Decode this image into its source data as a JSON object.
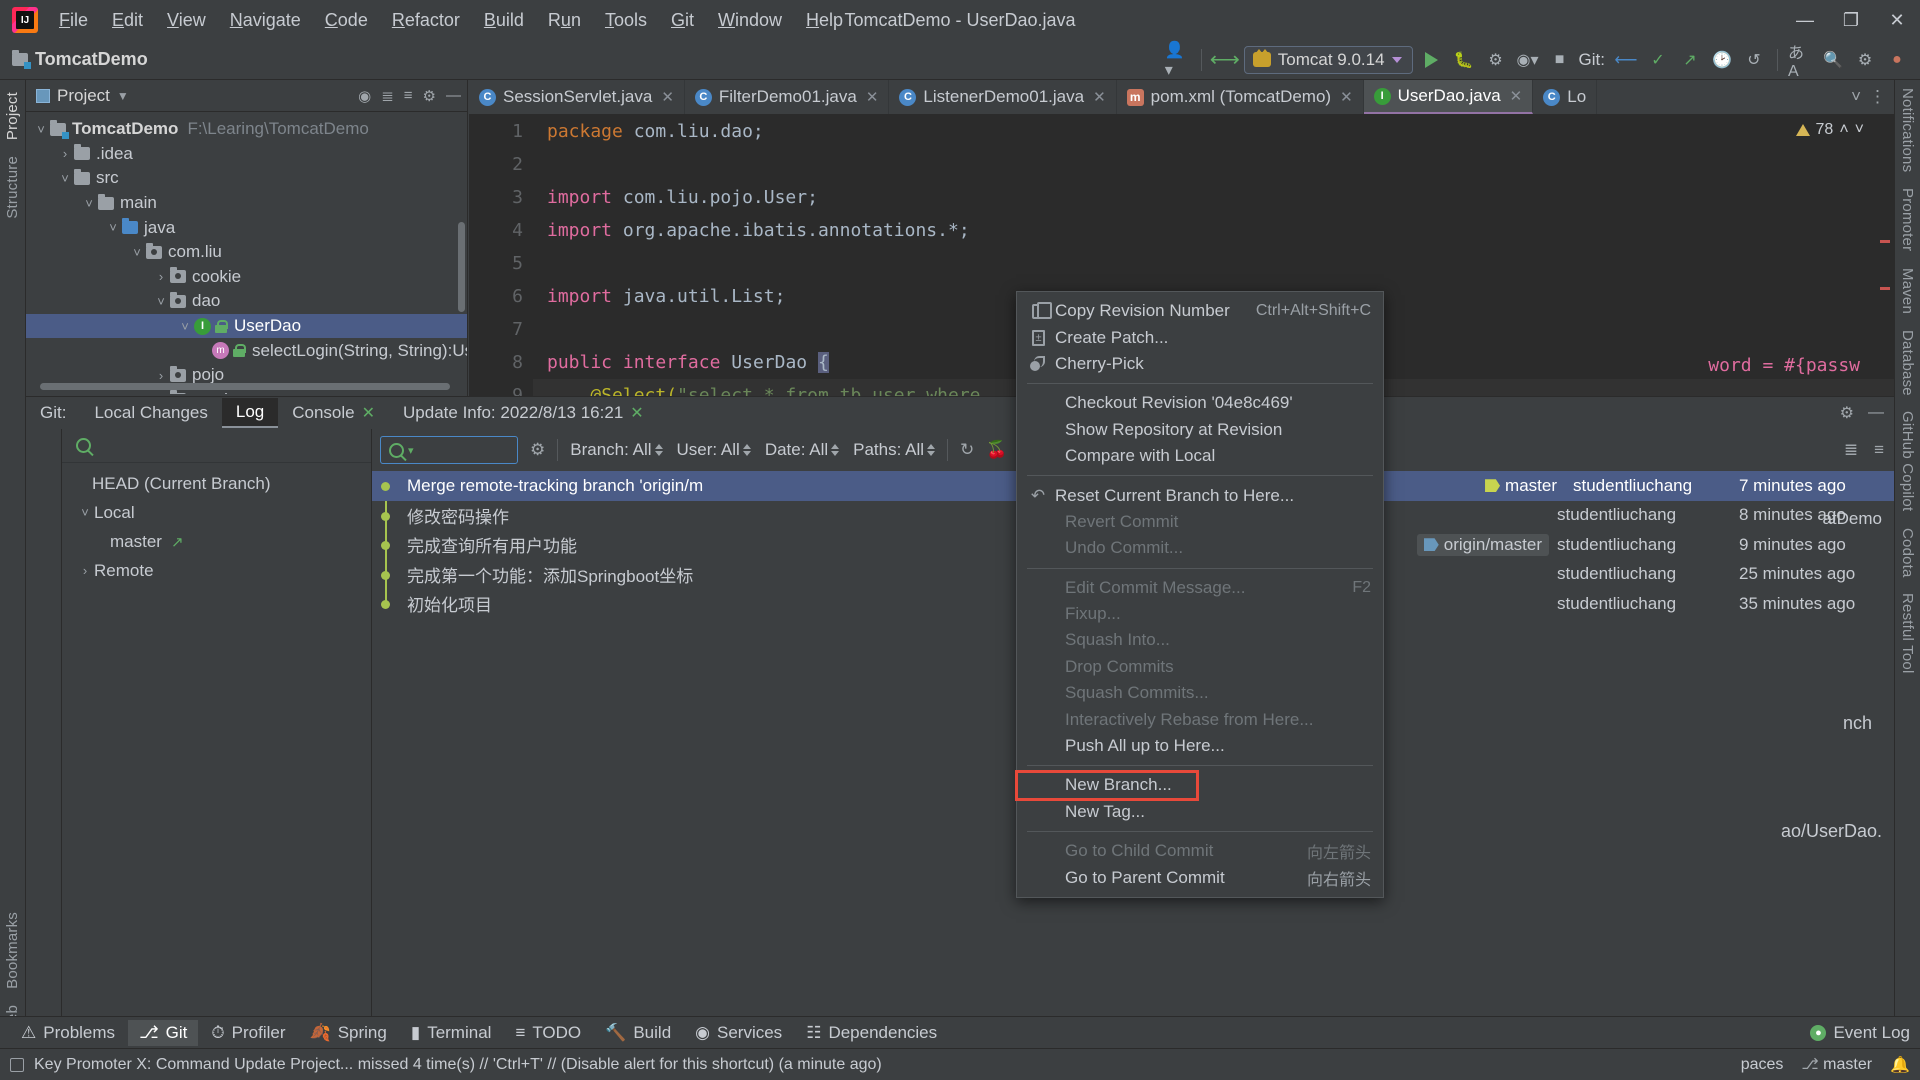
{
  "window": {
    "title": "TomcatDemo - UserDao.java",
    "controls": {
      "minimize": "—",
      "maximize": "❐",
      "close": "✕"
    }
  },
  "menubar": [
    {
      "label": "File",
      "mnemonic": "F"
    },
    {
      "label": "Edit",
      "mnemonic": "E"
    },
    {
      "label": "View",
      "mnemonic": "V"
    },
    {
      "label": "Navigate",
      "mnemonic": "N"
    },
    {
      "label": "Code",
      "mnemonic": "C"
    },
    {
      "label": "Refactor",
      "mnemonic": "R"
    },
    {
      "label": "Build",
      "mnemonic": "B"
    },
    {
      "label": "Run",
      "mnemonic": "u"
    },
    {
      "label": "Tools",
      "mnemonic": "T"
    },
    {
      "label": "Git",
      "mnemonic": "G"
    },
    {
      "label": "Window",
      "mnemonic": "W"
    },
    {
      "label": "Help",
      "mnemonic": "H"
    }
  ],
  "toolbar": {
    "project_name": "TomcatDemo",
    "run_config": "Tomcat 9.0.14",
    "git_label": "Git:"
  },
  "left_strip": {
    "top": [
      "Project",
      "Structure"
    ],
    "bottom": [
      "Bookmarks",
      "Web"
    ]
  },
  "right_strip": {
    "top": [
      "Notifications",
      "Promoter",
      "Maven",
      "Database"
    ],
    "bottom": [
      "Codota",
      "Restful Tool",
      "GitHub Copilot"
    ]
  },
  "project_tool_window": {
    "title": "Project",
    "tree": [
      {
        "label": "TomcatDemo",
        "path": "F:\\Learing\\TomcatDemo",
        "indent": 0,
        "chev": "v",
        "icon": "module-folder",
        "bold": true
      },
      {
        "label": ".idea",
        "indent": 1,
        "chev": ">",
        "icon": "folder"
      },
      {
        "label": "src",
        "indent": 1,
        "chev": "v",
        "icon": "folder"
      },
      {
        "label": "main",
        "indent": 2,
        "chev": "v",
        "icon": "folder"
      },
      {
        "label": "java",
        "indent": 3,
        "chev": "v",
        "icon": "source-folder"
      },
      {
        "label": "com.liu",
        "indent": 4,
        "chev": "v",
        "icon": "package"
      },
      {
        "label": "cookie",
        "indent": 5,
        "chev": ">",
        "icon": "package"
      },
      {
        "label": "dao",
        "indent": 5,
        "chev": "v",
        "icon": "package"
      },
      {
        "label": "UserDao",
        "indent": 6,
        "chev": "v",
        "icon": "interface",
        "selected": true,
        "lock": true
      },
      {
        "label": "selectLogin(String, String):User",
        "indent": 7,
        "chev": "",
        "icon": "method",
        "lock": true
      },
      {
        "label": "pojo",
        "indent": 5,
        "chev": ">",
        "icon": "package"
      },
      {
        "label": "service",
        "indent": 5,
        "chev": ">",
        "icon": "package"
      }
    ]
  },
  "editor": {
    "tabs": [
      {
        "label": "SessionServlet.java",
        "icon": "class-blue",
        "closable": true
      },
      {
        "label": "FilterDemo01.java",
        "icon": "class-c",
        "closable": true
      },
      {
        "label": "ListenerDemo01.java",
        "icon": "class-c",
        "closable": true
      },
      {
        "label": "pom.xml (TomcatDemo)",
        "icon": "maven",
        "closable": true
      },
      {
        "label": "UserDao.java",
        "icon": "interface",
        "closable": true,
        "active": true
      },
      {
        "label": "Lo",
        "icon": "class-c",
        "closable": false
      }
    ],
    "warning_count": "78",
    "lines": [
      {
        "n": "1",
        "html": "<span class=\"kw\">package</span> <span class=\"pkgc\">com.liu.dao;</span>"
      },
      {
        "n": "2",
        "html": ""
      },
      {
        "n": "3",
        "html": "<span class=\"kwp\">import</span> <span class=\"pkgc\">com.liu.pojo.User;</span>",
        "fold": "−"
      },
      {
        "n": "4",
        "html": "<span class=\"kwp\">import</span> <span class=\"pkgc\">org.apache.ibatis.annotations.*;</span>"
      },
      {
        "n": "5",
        "html": ""
      },
      {
        "n": "6",
        "html": "<span class=\"kwp\">import</span> <span class=\"pkgc\">java.util.List;</span>",
        "fold": "⌐"
      },
      {
        "n": "7",
        "html": ""
      },
      {
        "n": "8",
        "html": "<span class=\"kwp\">public</span> <span class=\"kwp\">interface</span> <span class=\"cls\">UserDao</span> <span class=\"sel-br\">{</span>"
      },
      {
        "n": "9",
        "html": "    <span class=\"anno\">@Select(</span><span class=\"str\">\"select * from tb_user where</span>"
      }
    ],
    "code_tail": "word = #{passw"
  },
  "git_tool_window": {
    "label": "Git:",
    "tabs": [
      {
        "label": "Local Changes",
        "active": false,
        "closable": false
      },
      {
        "label": "Log",
        "active": true,
        "closable": false
      },
      {
        "label": "Console",
        "active": false,
        "closable": true
      },
      {
        "label": "Update Info: 2022/8/13 16:21",
        "active": false,
        "closable": true
      }
    ],
    "branch_panel": [
      {
        "label": "HEAD (Current Branch)",
        "indent": 1,
        "chev": ""
      },
      {
        "label": "Local",
        "indent": 0,
        "chev": "v"
      },
      {
        "label": "master",
        "indent": 1,
        "chev": "",
        "arrow": "↗"
      },
      {
        "label": "Remote",
        "indent": 0,
        "chev": ">"
      }
    ],
    "log_filters": {
      "search_placeholder": "",
      "branch": "Branch: All",
      "user": "User: All",
      "date": "Date: All",
      "paths": "Paths: All"
    },
    "commits": [
      {
        "message": "Merge remote-tracking branch 'origin/m",
        "tag": "master",
        "author": "studentliuchang",
        "date": "7 minutes ago",
        "selected": true
      },
      {
        "message": "修改密码操作",
        "author": "studentliuchang",
        "date": "8 minutes ago"
      },
      {
        "message": "完成查询所有用户功能",
        "origin_tag": "origin/master",
        "author": "studentliuchang",
        "date": "9 minutes ago"
      },
      {
        "message": "完成第一个功能：添加Springboot坐标",
        "author": "studentliuchang",
        "date": "25 minutes ago"
      },
      {
        "message": "初始化项目",
        "author": "studentliuchang",
        "date": "35 minutes ago"
      }
    ],
    "detail_panel": [
      "atDemo",
      "nch",
      "ao/UserDao."
    ]
  },
  "context_menu": {
    "items": [
      {
        "label": "Copy Revision Number",
        "shortcut": "Ctrl+Alt+Shift+C",
        "icon": "copy-icon",
        "disabled": false
      },
      {
        "label": "Create Patch...",
        "shortcut": "",
        "icon": "patch-icon",
        "disabled": false
      },
      {
        "label": "Cherry-Pick",
        "shortcut": "",
        "icon": "cherry-icon",
        "disabled": false
      },
      {
        "separator": true
      },
      {
        "label": "Checkout Revision '04e8c469'",
        "shortcut": "",
        "icon": "",
        "disabled": false
      },
      {
        "label": "Show Repository at Revision",
        "shortcut": "",
        "icon": "",
        "disabled": false
      },
      {
        "label": "Compare with Local",
        "shortcut": "",
        "icon": "",
        "disabled": false
      },
      {
        "separator": true
      },
      {
        "label": "Reset Current Branch to Here...",
        "shortcut": "",
        "icon": "reset-icon",
        "disabled": false
      },
      {
        "label": "Revert Commit",
        "shortcut": "",
        "icon": "",
        "disabled": true
      },
      {
        "label": "Undo Commit...",
        "shortcut": "",
        "icon": "",
        "disabled": true
      },
      {
        "separator": true
      },
      {
        "label": "Edit Commit Message...",
        "shortcut": "F2",
        "icon": "",
        "disabled": true
      },
      {
        "label": "Fixup...",
        "shortcut": "",
        "icon": "",
        "disabled": true
      },
      {
        "label": "Squash Into...",
        "shortcut": "",
        "icon": "",
        "disabled": true
      },
      {
        "label": "Drop Commits",
        "shortcut": "",
        "icon": "",
        "disabled": true
      },
      {
        "label": "Squash Commits...",
        "shortcut": "",
        "icon": "",
        "disabled": true
      },
      {
        "label": "Interactively Rebase from Here...",
        "shortcut": "",
        "icon": "",
        "disabled": true
      },
      {
        "label": "Push All up to Here...",
        "shortcut": "",
        "icon": "",
        "disabled": false
      },
      {
        "separator": true
      },
      {
        "label": "New Branch...",
        "shortcut": "",
        "icon": "",
        "disabled": false,
        "highlighted": true
      },
      {
        "label": "New Tag...",
        "shortcut": "",
        "icon": "",
        "disabled": false
      },
      {
        "separator": true
      },
      {
        "label": "Go to Child Commit",
        "shortcut": "向左箭头",
        "icon": "",
        "disabled": true
      },
      {
        "label": "Go to Parent Commit",
        "shortcut": "向右箭头",
        "icon": "",
        "disabled": false
      }
    ]
  },
  "bottom_tabs": [
    {
      "label": "Problems",
      "icon": "problems-icon",
      "active": false
    },
    {
      "label": "Git",
      "icon": "git-icon",
      "active": true
    },
    {
      "label": "Profiler",
      "icon": "profiler-icon",
      "active": false
    },
    {
      "label": "Spring",
      "icon": "spring-icon",
      "active": false
    },
    {
      "label": "Terminal",
      "icon": "terminal-icon",
      "active": false
    },
    {
      "label": "TODO",
      "icon": "todo-icon",
      "active": false
    },
    {
      "label": "Build",
      "icon": "build-icon",
      "active": false
    },
    {
      "label": "Services",
      "icon": "services-icon",
      "active": false
    },
    {
      "label": "Dependencies",
      "icon": "dependencies-icon",
      "active": false
    }
  ],
  "event_log": "Event Log",
  "status_bar": {
    "message": "Key Promoter X: Command Update Project... missed 4 time(s) // 'Ctrl+T' // (Disable alert for this shortcut) (a minute ago)",
    "right": [
      "paces",
      "master"
    ]
  }
}
